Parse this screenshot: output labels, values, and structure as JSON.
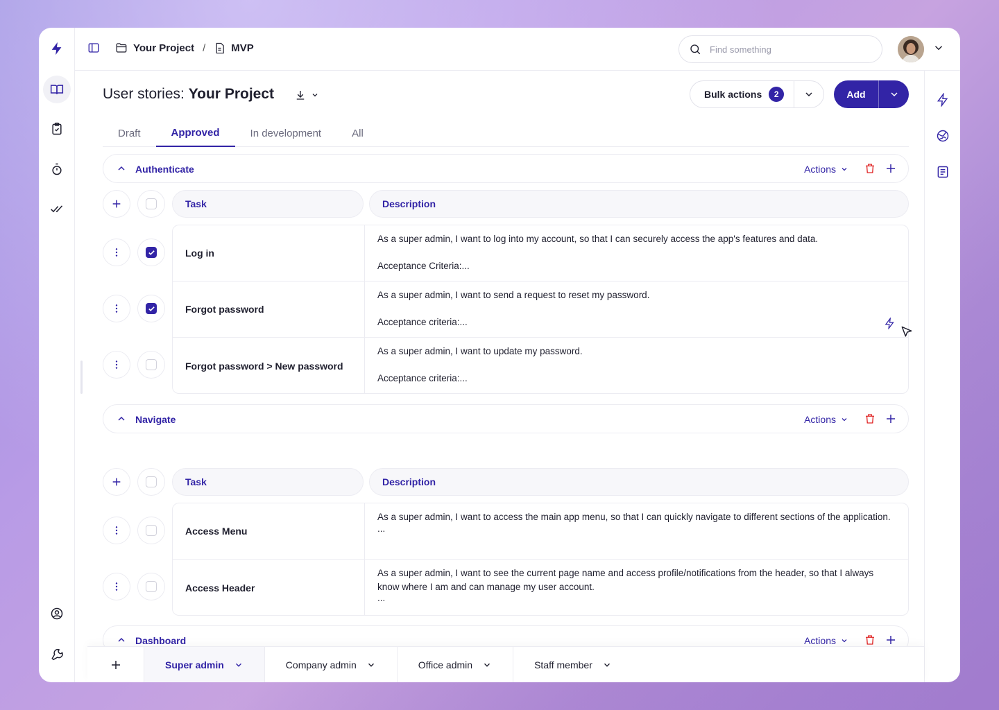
{
  "topbar": {
    "breadcrumb": [
      {
        "label": "Your Project",
        "icon": "folder-icon"
      },
      {
        "label": "MVP",
        "icon": "document-icon"
      }
    ],
    "separator": "/",
    "search_placeholder": "Find something"
  },
  "page": {
    "title_prefix": "User stories:",
    "title_project": "Your Project",
    "bulk_label": "Bulk actions",
    "bulk_count": "2",
    "add_label": "Add"
  },
  "tabs": [
    "Draft",
    "Approved",
    "In development",
    "All"
  ],
  "active_tab": "Approved",
  "columns": {
    "task": "Task",
    "description": "Description"
  },
  "groups": [
    {
      "title": "Authenticate",
      "actions_label": "Actions",
      "rows": [
        {
          "task": "Log in",
          "checked": true,
          "desc": "As a super admin, I want to log into my account, so that I can securely access the app's features and data.",
          "extra": "Acceptance Criteria:..."
        },
        {
          "task": "Forgot password",
          "checked": true,
          "desc": "As a super admin, I want to send a request to reset my password.",
          "extra": "Acceptance criteria:..."
        },
        {
          "task": "Forgot password > New password",
          "checked": false,
          "desc": "As a super admin, I want to update my password.",
          "extra": "Acceptance criteria:..."
        }
      ]
    },
    {
      "title": "Navigate",
      "actions_label": "Actions",
      "rows": [
        {
          "task": "Access Menu",
          "checked": false,
          "desc": "As a super admin, I want to access the main app menu, so that I can quickly navigate to different sections of the application.",
          "extra": "..."
        },
        {
          "task": "Access Header",
          "checked": false,
          "desc": "As a super admin, I want to see the current page name and access profile/notifications from the header, so that I always know where I am and can manage my user account.",
          "extra": "..."
        }
      ]
    },
    {
      "title": "Dashboard",
      "actions_label": "Actions",
      "rows": []
    }
  ],
  "roles": [
    "Super admin",
    "Company admin",
    "Office admin",
    "Staff member"
  ],
  "active_role": "Super admin",
  "colors": {
    "accent": "#3224a6",
    "danger": "#e02424",
    "border": "#ececf2"
  }
}
